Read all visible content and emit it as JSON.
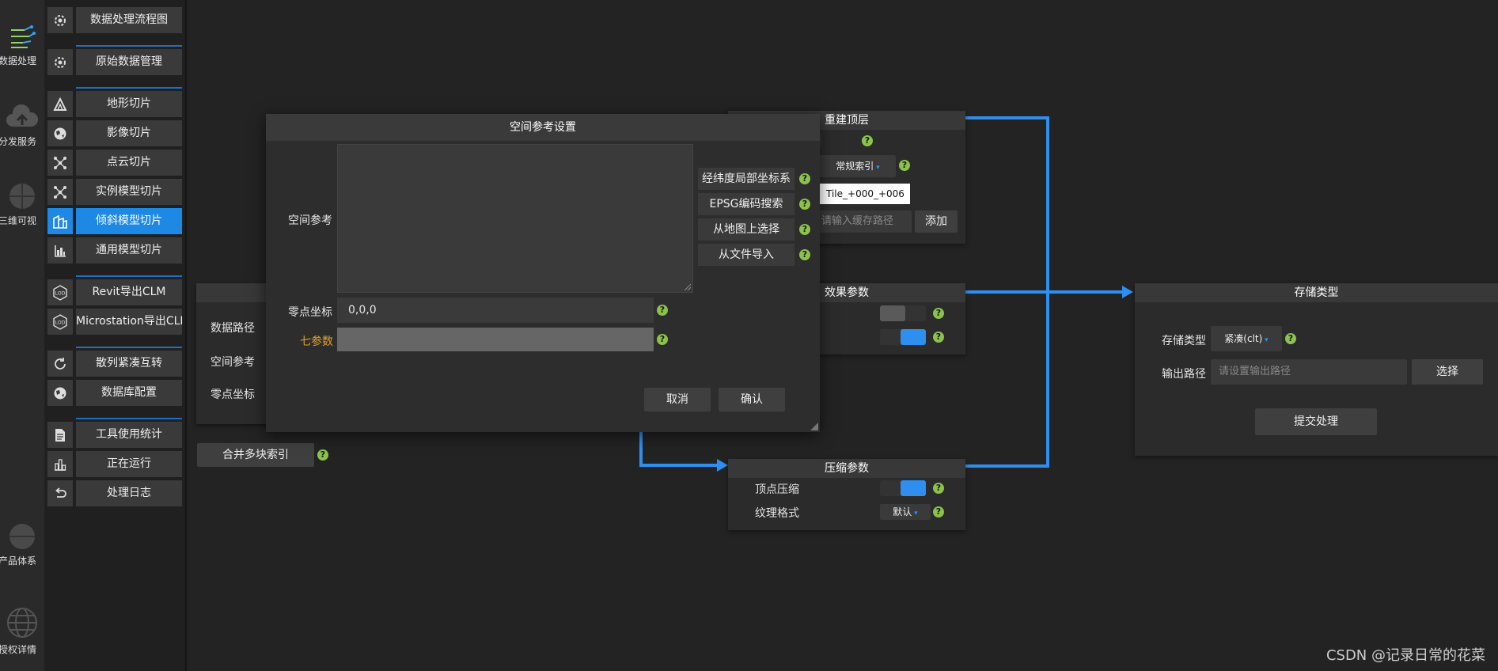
{
  "rail": [
    {
      "label": "数据处理",
      "icon": "data-process-icon"
    },
    {
      "label": "分发服务",
      "icon": "cloud-icon"
    },
    {
      "label": "三维可视",
      "icon": "globe-icon"
    },
    {
      "label": "产品体系",
      "icon": "product-globe-icon"
    },
    {
      "label": "授权详情",
      "icon": "globe-grid-icon"
    }
  ],
  "menu": [
    {
      "label": "数据处理流程图",
      "icon": "gear-icon"
    },
    {
      "label": "原始数据管理",
      "icon": "gear-icon"
    },
    {
      "label": "地形切片",
      "icon": "mountain-icon"
    },
    {
      "label": "影像切片",
      "icon": "earth-icon"
    },
    {
      "label": "点云切片",
      "icon": "nodes-icon"
    },
    {
      "label": "实例模型切片",
      "icon": "nodes-icon"
    },
    {
      "label": "倾斜模型切片",
      "icon": "building-icon"
    },
    {
      "label": "通用模型切片",
      "icon": "chart-icon"
    },
    {
      "label": "Revit导出CLM",
      "icon": "hexagon-icon"
    },
    {
      "label": "Microstation导出CLM",
      "icon": "hexagon-icon"
    },
    {
      "label": "散列紧凑互转",
      "icon": "refresh-icon"
    },
    {
      "label": "数据库配置",
      "icon": "earth-icon"
    },
    {
      "label": "工具使用统计",
      "icon": "document-icon"
    },
    {
      "label": "正在运行",
      "icon": "chart-icon"
    },
    {
      "label": "处理日志",
      "icon": "undo-icon"
    }
  ],
  "input_panel": {
    "rows": [
      "数据路径",
      "空间参考",
      "零点坐标"
    ],
    "merge_button": "合并多块索引"
  },
  "rebuild_panel": {
    "title": "重建顶层",
    "index_select": "常规索引",
    "tile_value": "Tile_+000_+006",
    "cache_placeholder": "请输入缓存路径",
    "add_button": "添加"
  },
  "effect_panel": {
    "title": "效果参数"
  },
  "compress_panel": {
    "title": "压缩参数",
    "vertex_label": "顶点压缩",
    "texture_label": "纹理格式",
    "texture_value": "默认"
  },
  "storage_panel": {
    "title": "存储类型",
    "type_label": "存储类型",
    "type_value": "紧凑(clt)",
    "output_label": "输出路径",
    "output_placeholder": "请设置输出路径",
    "choose_button": "选择",
    "submit_button": "提交处理"
  },
  "dialog": {
    "title": "空间参考设置",
    "spatial_label": "空间参考",
    "origin_label": "零点坐标",
    "origin_value": "0,0,0",
    "seven_label": "七参数",
    "side_buttons": [
      "经纬度局部坐标系",
      "EPSG编码搜索",
      "从地图上选择",
      "从文件导入"
    ],
    "cancel": "取消",
    "confirm": "确认"
  },
  "watermark": "CSDN @记录日常的花菜",
  "colors": {
    "accent": "#1e88e5",
    "wire": "#2f8ff0",
    "help": "#8bc34a",
    "seven_label": "#e0a030"
  }
}
